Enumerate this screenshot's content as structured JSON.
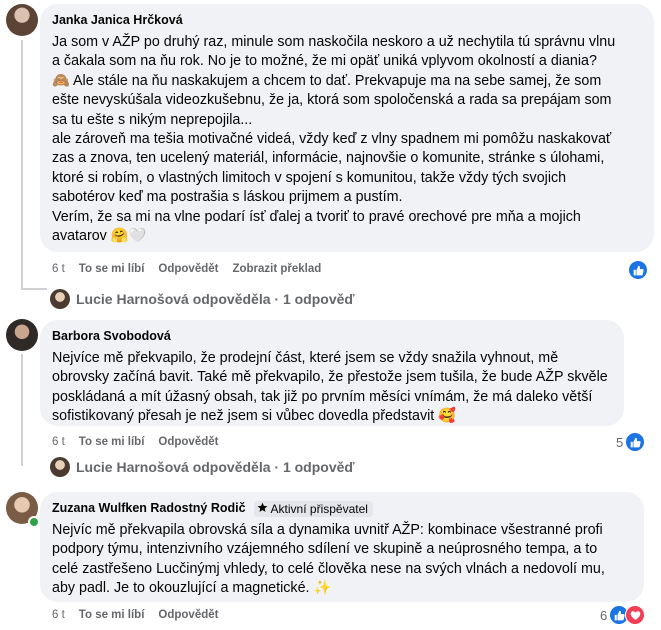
{
  "comments": [
    {
      "author": "Janka Janica Hrčková",
      "lines": [
        "Ja som v AŽP po druhý raz, minule som naskočila neskoro a už nechytila tú správnu vlnu",
        "a čakala som na ňu rok. No je to možné, že mi opäť uniká vplyvom okolností a diania?",
        "🙈 Ale stále na ňu naskakujem a chcem to dať. Prekvapuje ma na sebe samej, že som",
        "ešte nevyskúšala videozkušebnu, že ja, ktorá som spoločenská a rada sa prepájam som",
        "sa tu ešte s nikým neprepojila...",
        "ale zároveň ma tešia motivačné videá, vždy keď z vlny spadnem mi pomôžu naskakovať",
        "zas a znova, ten ucelený materiál, informácie, najnovšie o komunite, stránke s úlohami,",
        "ktoré si robím, o vlastných limitoch v spojení s komunitou, takže vždy tých svojich",
        "sabotérov keď ma postrašia s láskou prijmem a pustím.",
        "Verím, že sa mi na vlne podarí ísť ďalej a tvoriť to pravé orechové pre mňa a mojich",
        "avatarov 🤗🤍"
      ],
      "time": "6 t",
      "like_label": "To se mi líbí",
      "reply_label": "Odpovědět",
      "translate_label": "Zobrazit překlad",
      "reaction_count": "",
      "reply_summary": "Lucie Harnošová odpověděla · 1 odpověď"
    },
    {
      "author": "Barbora Svobodová",
      "lines": [
        "Nejvíce mě překvapilo, že prodejní část, které jsem se vždy snažila vyhnout, mě",
        "obrovsky začíná bavit. Také mě překvapilo, že přestože jsem tušila, že bude AŽP skvěle",
        "poskládaná a mít úžasný obsah, tak již po prvním měsíci vnímám, že má daleko větší",
        "sofistikovaný přesah je než jsem si vůbec dovedla představit 🥰"
      ],
      "time": "6 t",
      "like_label": "To se mi líbí",
      "reply_label": "Odpovědět",
      "reaction_count": "5",
      "reply_summary": "Lucie Harnošová odpověděla · 1 odpověď"
    },
    {
      "author": "Zuzana Wulfken Radostný Rodič",
      "badge": "Aktivní přispěvatel",
      "lines": [
        "Nejvíc mě překvapila obrovská síla a dynamika uvnitř AŽP: kombinace všestranné profi",
        "podpory týmu, intenzivního vzájemného sdílení ve skupině a neúprosného tempa, a to",
        "celé zastřešeno Lucčinýmj vhledy, to celé člověka nese na svých vlnách a nedovolí mu,",
        "aby padl. Je to okouzlující a magnetické. ✨"
      ],
      "time": "6 t",
      "like_label": "To se mi líbí",
      "reply_label": "Odpovědět",
      "reaction_count": "6"
    }
  ],
  "colors": {
    "bubble": "#f0f2f5",
    "meta": "#65676b",
    "like_blue": "#1b74e4",
    "love_red": "#f33e58",
    "online_green": "#31a24c"
  },
  "icons": [
    "like-icon",
    "love-icon",
    "star-icon"
  ]
}
